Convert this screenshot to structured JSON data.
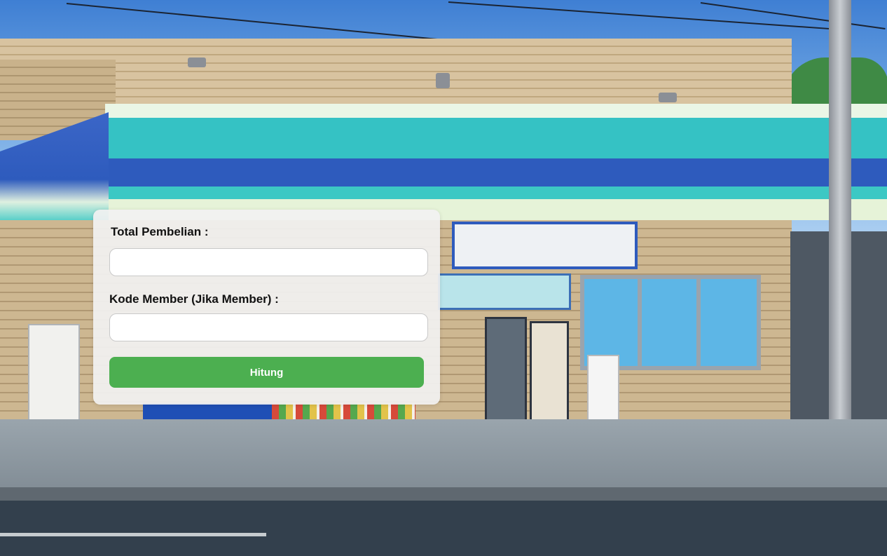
{
  "form": {
    "total_label": "Total Pembelian :",
    "total_value": "",
    "member_label": "Kode Member (Jika Member) :",
    "member_value": "",
    "submit_label": "Hitung"
  },
  "colors": {
    "button": "#4caf50",
    "card": "#f1f1f1"
  }
}
